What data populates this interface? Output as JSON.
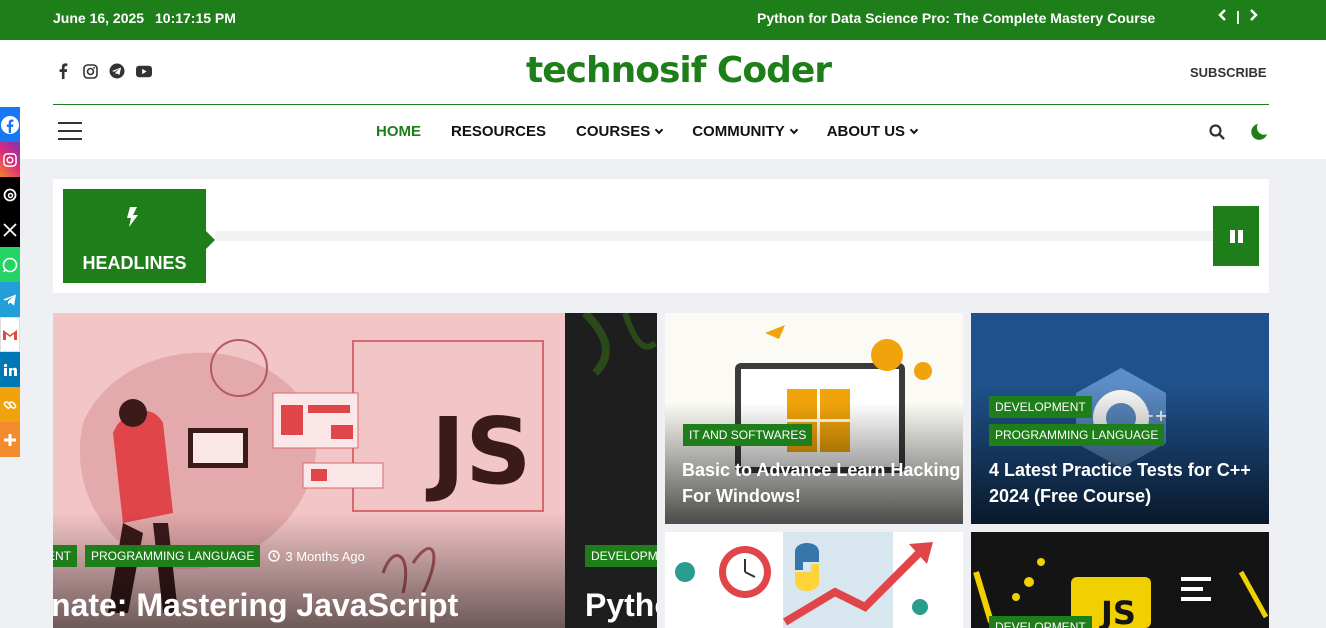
{
  "topbar": {
    "date": "June 16, 2025",
    "time": "10:17:15 PM",
    "ticker": "Python for Data Science Pro: The Complete Mastery Course",
    "prev_icon": "chevron-left-icon",
    "divider": "|",
    "next_icon": "chevron-right-icon"
  },
  "header": {
    "logo": "technosif Coder",
    "subscribe": "SUBSCRIBE",
    "socials": [
      "facebook-icon",
      "instagram-icon",
      "telegram-icon",
      "youtube-icon"
    ]
  },
  "nav": {
    "items": [
      {
        "label": "HOME",
        "active": true
      },
      {
        "label": "RESOURCES"
      },
      {
        "label": "COURSES"
      },
      {
        "label": "COMMUNITY"
      },
      {
        "label": "ABOUT US"
      }
    ]
  },
  "headlines": {
    "label": "HEADLINES",
    "pause_icon": "pause-icon"
  },
  "sidebar": {
    "colors": [
      "#1877f2",
      "#e1306c",
      "#000000",
      "#000000",
      "#25d366",
      "#229ed9",
      "#dd4b39",
      "#0077b5",
      "#f0a30a",
      "#f28a2e"
    ]
  },
  "cards": {
    "main": {
      "tags": [
        "ENT",
        "PROGRAMMING LANGUAGE"
      ],
      "meta": "3 Months Ago",
      "title": "nate: Mastering JavaScript",
      "bg_text": "JS"
    },
    "second": {
      "tag": "DEVELOPME",
      "title": "Pytho"
    },
    "c1": {
      "tag": "IT AND SOFTWARES",
      "title_line1": "Basic to Advance Learn Hacking",
      "title_line2": "For Windows!"
    },
    "c2": {
      "tags": [
        "DEVELOPMENT",
        "PROGRAMMING LANGUAGE"
      ],
      "title_line1": "4 Latest Practice Tests for C++",
      "title_line2": "2024 (Free Course)"
    },
    "c4": {
      "tag": "DEVELOPMENT"
    }
  },
  "colors": {
    "brand": "#1e7e1a",
    "top_bar": "#1e7e1a",
    "page_bg": "#eef0f3"
  }
}
